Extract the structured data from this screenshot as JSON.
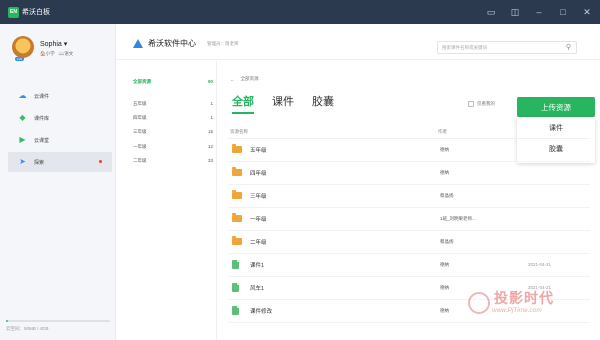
{
  "titlebar": {
    "app_name": "希沃白板",
    "logo_text": "EN"
  },
  "profile": {
    "name": "Sophia",
    "badge": "LV6",
    "school": "小学",
    "subject": "语文"
  },
  "nav": [
    {
      "label": "云课件"
    },
    {
      "label": "课件库"
    },
    {
      "label": "云课堂"
    },
    {
      "label": "探索"
    }
  ],
  "storage": {
    "text": "云空间：50MB / 4GB",
    "used_fraction": 0.012
  },
  "header": {
    "brand": "希沃软件中心",
    "admin": "管理员：周老师"
  },
  "search": {
    "placeholder": "搜索课件名称或关键词"
  },
  "categories": [
    {
      "label": "全部资源",
      "count": "90"
    },
    {
      "label": "五年级",
      "count": "1"
    },
    {
      "label": "四年级",
      "count": "1"
    },
    {
      "label": "三年级",
      "count": "15"
    },
    {
      "label": "一年级",
      "count": "12"
    },
    {
      "label": "二年级",
      "count": "33"
    }
  ],
  "breadcrumb": {
    "back": "←",
    "text": "全部资源"
  },
  "tabs": [
    {
      "label": "全部"
    },
    {
      "label": "课件"
    },
    {
      "label": "胶囊"
    }
  ],
  "only_mine": "仅看我的",
  "upload": {
    "label": "上传资源",
    "options": [
      "课件",
      "胶囊"
    ]
  },
  "table": {
    "headers": {
      "name": "资源名称",
      "author": "作者"
    },
    "rows": [
      {
        "type": "folder",
        "name": "五年级",
        "author": "德纳",
        "date": ""
      },
      {
        "type": "folder",
        "name": "四年级",
        "author": "德纳",
        "date": ""
      },
      {
        "type": "folder",
        "name": "三年级",
        "author": "蔡晶扬",
        "date": ""
      },
      {
        "type": "folder",
        "name": "一年级",
        "author": "1班_刘明果老师...",
        "date": ""
      },
      {
        "type": "folder",
        "name": "二年级",
        "author": "蔡晶扬",
        "date": ""
      },
      {
        "type": "file",
        "name": "课件1",
        "author": "德纳",
        "date": "2021-04-21"
      },
      {
        "type": "file",
        "name": "风车1",
        "author": "德纳",
        "date": "2021-04-21"
      },
      {
        "type": "file",
        "name": "课件修改",
        "author": "德纳",
        "date": ""
      }
    ]
  },
  "watermark": {
    "cn": "投影时代",
    "url": "www.PjTime.com"
  },
  "colors": {
    "accent": "#28b55f",
    "titlebar": "#2b3a4f",
    "folder": "#f0a53a"
  }
}
